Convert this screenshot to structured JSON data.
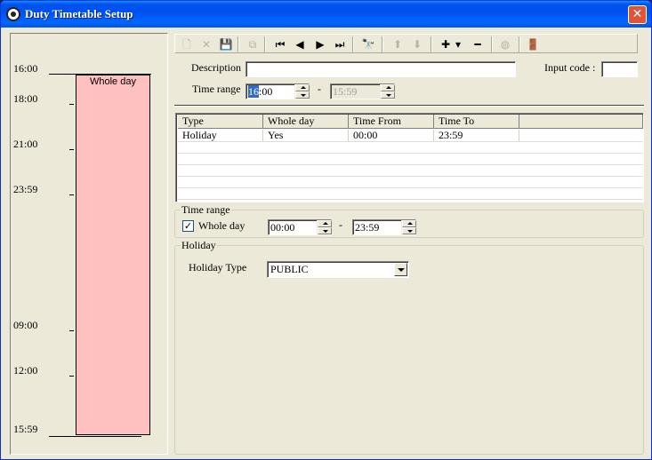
{
  "window": {
    "title": "Duty Timetable Setup",
    "close_label": "✕"
  },
  "timeline": {
    "labels": [
      "16:00",
      "18:00",
      "21:00",
      "23:59",
      "09:00",
      "12:00",
      "15:59"
    ],
    "bar_label": "Whole day",
    "bar_color": "#ffc0c0"
  },
  "toolbar": {
    "new": "🗋",
    "delete": "✕",
    "save": "💾",
    "copy": "⧉",
    "first": "⏮",
    "prev": "◀",
    "next": "▶",
    "last": "⏭",
    "find": "🔭",
    "up": "⬆",
    "down": "⬇",
    "add": "✚",
    "add_arrow": "▾",
    "remove": "━",
    "disabled": "◍",
    "exit": "🚪"
  },
  "form": {
    "description_label": "Description",
    "description_value": "",
    "input_code_label": "Input code :",
    "input_code_value": "",
    "time_range_label": "Time range",
    "time_from_hours": "16",
    "time_from_rest": ":00",
    "time_sep": "-",
    "time_to_value": "15:59"
  },
  "grid": {
    "columns": [
      "Type",
      "Whole day",
      "Time From",
      "Time To"
    ],
    "rows": [
      [
        "Holiday",
        "Yes",
        "00:00",
        "23:59"
      ]
    ]
  },
  "time_range_group": {
    "title": "Time range",
    "whole_day_checked": true,
    "check_mark": "✓",
    "whole_day_label": "Whole day",
    "from_value": "00:00",
    "sep": "-",
    "to_value": "23:59"
  },
  "holiday_group": {
    "title": "Holiday",
    "type_label": "Holiday Type",
    "type_value": "PUBLIC"
  }
}
